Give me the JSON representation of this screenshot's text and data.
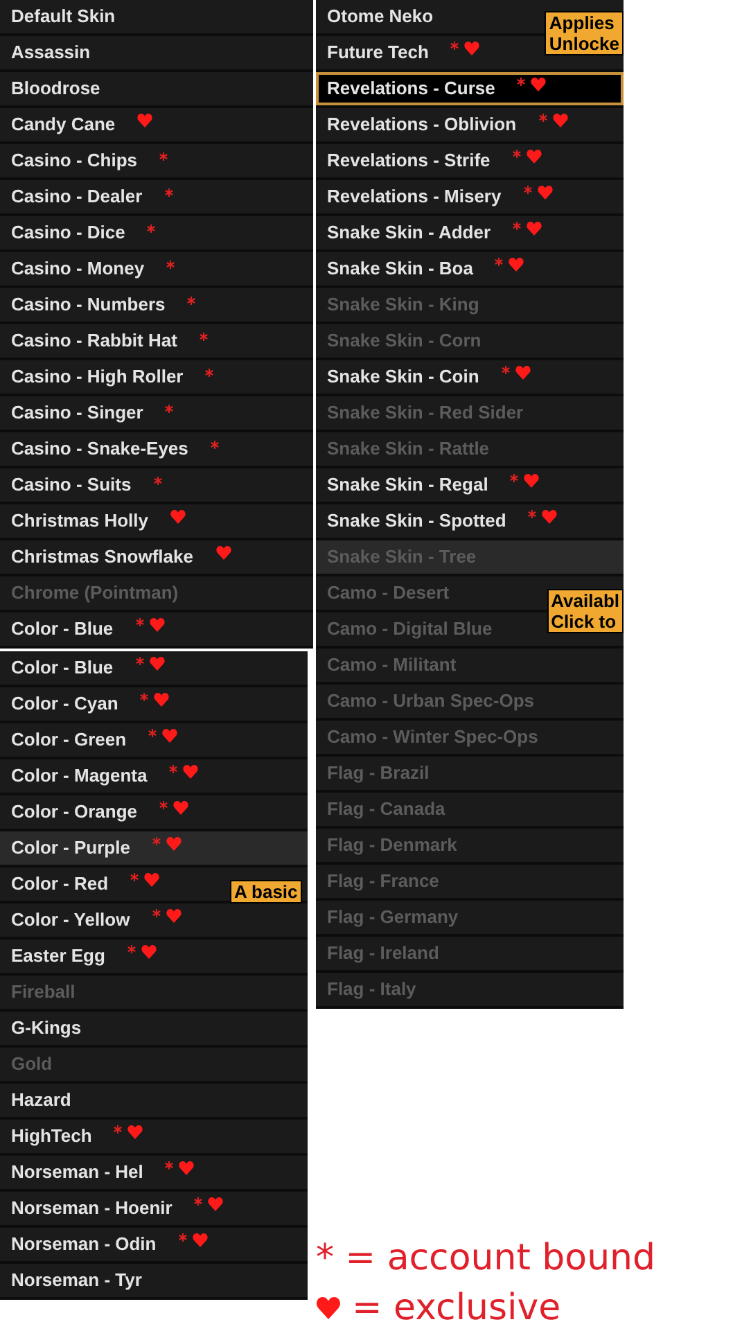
{
  "panels": [
    {
      "rows": [
        {
          "label": "Default Skin",
          "disabled": false,
          "account_bound": false,
          "exclusive": false,
          "selected": false,
          "highlighted": false
        },
        {
          "label": "Assassin",
          "disabled": false,
          "account_bound": false,
          "exclusive": false,
          "selected": false,
          "highlighted": false
        },
        {
          "label": "Bloodrose",
          "disabled": false,
          "account_bound": false,
          "exclusive": false,
          "selected": false,
          "highlighted": false
        },
        {
          "label": "Candy Cane",
          "disabled": false,
          "account_bound": false,
          "exclusive": true,
          "selected": false,
          "highlighted": false
        },
        {
          "label": "Casino - Chips",
          "disabled": false,
          "account_bound": true,
          "exclusive": false,
          "selected": false,
          "highlighted": false
        },
        {
          "label": "Casino - Dealer",
          "disabled": false,
          "account_bound": true,
          "exclusive": false,
          "selected": false,
          "highlighted": false
        },
        {
          "label": "Casino - Dice",
          "disabled": false,
          "account_bound": true,
          "exclusive": false,
          "selected": false,
          "highlighted": false
        },
        {
          "label": "Casino - Money",
          "disabled": false,
          "account_bound": true,
          "exclusive": false,
          "selected": false,
          "highlighted": false
        },
        {
          "label": "Casino - Numbers",
          "disabled": false,
          "account_bound": true,
          "exclusive": false,
          "selected": false,
          "highlighted": false
        },
        {
          "label": "Casino - Rabbit Hat",
          "disabled": false,
          "account_bound": true,
          "exclusive": false,
          "selected": false,
          "highlighted": false
        },
        {
          "label": "Casino - High Roller",
          "disabled": false,
          "account_bound": true,
          "exclusive": false,
          "selected": false,
          "highlighted": false
        },
        {
          "label": "Casino - Singer",
          "disabled": false,
          "account_bound": true,
          "exclusive": false,
          "selected": false,
          "highlighted": false
        },
        {
          "label": "Casino - Snake-Eyes",
          "disabled": false,
          "account_bound": true,
          "exclusive": false,
          "selected": false,
          "highlighted": false
        },
        {
          "label": "Casino - Suits",
          "disabled": false,
          "account_bound": true,
          "exclusive": false,
          "selected": false,
          "highlighted": false
        },
        {
          "label": "Christmas Holly",
          "disabled": false,
          "account_bound": false,
          "exclusive": true,
          "selected": false,
          "highlighted": false
        },
        {
          "label": "Christmas Snowflake",
          "disabled": false,
          "account_bound": false,
          "exclusive": true,
          "selected": false,
          "highlighted": false
        },
        {
          "label": "Chrome (Pointman)",
          "disabled": true,
          "account_bound": false,
          "exclusive": false,
          "selected": false,
          "highlighted": false
        },
        {
          "label": "Color - Blue",
          "disabled": false,
          "account_bound": true,
          "exclusive": true,
          "selected": false,
          "highlighted": false
        }
      ]
    },
    {
      "rows": [
        {
          "label": "Color - Blue",
          "disabled": false,
          "account_bound": true,
          "exclusive": true,
          "selected": false,
          "highlighted": false
        },
        {
          "label": "Color - Cyan",
          "disabled": false,
          "account_bound": true,
          "exclusive": true,
          "selected": false,
          "highlighted": false
        },
        {
          "label": "Color - Green",
          "disabled": false,
          "account_bound": true,
          "exclusive": true,
          "selected": false,
          "highlighted": false
        },
        {
          "label": "Color - Magenta",
          "disabled": false,
          "account_bound": true,
          "exclusive": true,
          "selected": false,
          "highlighted": false
        },
        {
          "label": "Color - Orange",
          "disabled": false,
          "account_bound": true,
          "exclusive": true,
          "selected": false,
          "highlighted": false
        },
        {
          "label": "Color - Purple",
          "disabled": false,
          "account_bound": true,
          "exclusive": true,
          "selected": false,
          "highlighted": true
        },
        {
          "label": "Color - Red",
          "disabled": false,
          "account_bound": true,
          "exclusive": true,
          "selected": false,
          "highlighted": false
        },
        {
          "label": "Color - Yellow",
          "disabled": false,
          "account_bound": true,
          "exclusive": true,
          "selected": false,
          "highlighted": false
        },
        {
          "label": "Easter Egg",
          "disabled": false,
          "account_bound": true,
          "exclusive": true,
          "selected": false,
          "highlighted": false
        },
        {
          "label": "Fireball",
          "disabled": true,
          "account_bound": false,
          "exclusive": false,
          "selected": false,
          "highlighted": false
        },
        {
          "label": "G-Kings",
          "disabled": false,
          "account_bound": false,
          "exclusive": false,
          "selected": false,
          "highlighted": false
        },
        {
          "label": "Gold",
          "disabled": true,
          "account_bound": false,
          "exclusive": false,
          "selected": false,
          "highlighted": false
        },
        {
          "label": "Hazard",
          "disabled": false,
          "account_bound": false,
          "exclusive": false,
          "selected": false,
          "highlighted": false
        },
        {
          "label": "HighTech",
          "disabled": false,
          "account_bound": true,
          "exclusive": true,
          "selected": false,
          "highlighted": false
        },
        {
          "label": "Norseman - Hel",
          "disabled": false,
          "account_bound": true,
          "exclusive": true,
          "selected": false,
          "highlighted": false
        },
        {
          "label": "Norseman - Hoenir",
          "disabled": false,
          "account_bound": true,
          "exclusive": true,
          "selected": false,
          "highlighted": false
        },
        {
          "label": "Norseman - Odin",
          "disabled": false,
          "account_bound": true,
          "exclusive": true,
          "selected": false,
          "highlighted": false
        },
        {
          "label": "Norseman - Tyr",
          "disabled": false,
          "account_bound": false,
          "exclusive": false,
          "selected": false,
          "highlighted": false
        }
      ],
      "tooltip": {
        "lines": [
          "A basic"
        ]
      }
    },
    {
      "rows": [
        {
          "label": "Otome Neko",
          "disabled": false,
          "account_bound": false,
          "exclusive": false,
          "selected": false,
          "highlighted": false
        },
        {
          "label": "Future Tech",
          "disabled": false,
          "account_bound": true,
          "exclusive": true,
          "selected": false,
          "highlighted": false
        },
        {
          "label": "Revelations - Curse",
          "disabled": false,
          "account_bound": true,
          "exclusive": true,
          "selected": true,
          "highlighted": false
        },
        {
          "label": "Revelations - Oblivion",
          "disabled": false,
          "account_bound": true,
          "exclusive": true,
          "selected": false,
          "highlighted": false
        },
        {
          "label": "Revelations - Strife",
          "disabled": false,
          "account_bound": true,
          "exclusive": true,
          "selected": false,
          "highlighted": false
        },
        {
          "label": "Revelations - Misery",
          "disabled": false,
          "account_bound": true,
          "exclusive": true,
          "selected": false,
          "highlighted": false
        },
        {
          "label": "Snake Skin - Adder",
          "disabled": false,
          "account_bound": true,
          "exclusive": true,
          "selected": false,
          "highlighted": false
        },
        {
          "label": "Snake Skin - Boa",
          "disabled": false,
          "account_bound": true,
          "exclusive": true,
          "selected": false,
          "highlighted": false
        },
        {
          "label": "Snake Skin - King",
          "disabled": true,
          "account_bound": false,
          "exclusive": false,
          "selected": false,
          "highlighted": false
        },
        {
          "label": "Snake Skin - Corn",
          "disabled": true,
          "account_bound": false,
          "exclusive": false,
          "selected": false,
          "highlighted": false
        }
      ],
      "tooltip": {
        "lines": [
          "Applies",
          "Unlocke"
        ]
      }
    },
    {
      "rows": [
        {
          "label": "Snake Skin - Coin",
          "disabled": false,
          "account_bound": true,
          "exclusive": true,
          "selected": false,
          "highlighted": false
        },
        {
          "label": "Snake Skin - Red Sider",
          "disabled": true,
          "account_bound": false,
          "exclusive": false,
          "selected": false,
          "highlighted": false
        },
        {
          "label": "Snake Skin - Rattle",
          "disabled": true,
          "account_bound": false,
          "exclusive": false,
          "selected": false,
          "highlighted": false
        },
        {
          "label": "Snake Skin - Regal",
          "disabled": false,
          "account_bound": true,
          "exclusive": true,
          "selected": false,
          "highlighted": false
        },
        {
          "label": "Snake Skin - Spotted",
          "disabled": false,
          "account_bound": true,
          "exclusive": true,
          "selected": false,
          "highlighted": false
        },
        {
          "label": "Snake Skin - Tree",
          "disabled": true,
          "account_bound": false,
          "exclusive": false,
          "selected": false,
          "highlighted": true
        },
        {
          "label": "Camo - Desert",
          "disabled": true,
          "account_bound": false,
          "exclusive": false,
          "selected": false,
          "highlighted": false
        },
        {
          "label": "Camo - Digital Blue",
          "disabled": true,
          "account_bound": false,
          "exclusive": false,
          "selected": false,
          "highlighted": false
        },
        {
          "label": "Camo - Militant",
          "disabled": true,
          "account_bound": false,
          "exclusive": false,
          "selected": false,
          "highlighted": false
        },
        {
          "label": "Camo - Urban Spec-Ops",
          "disabled": true,
          "account_bound": false,
          "exclusive": false,
          "selected": false,
          "highlighted": false
        },
        {
          "label": "Camo - Winter Spec-Ops",
          "disabled": true,
          "account_bound": false,
          "exclusive": false,
          "selected": false,
          "highlighted": false
        },
        {
          "label": "Flag - Brazil",
          "disabled": true,
          "account_bound": false,
          "exclusive": false,
          "selected": false,
          "highlighted": false
        },
        {
          "label": "Flag - Canada",
          "disabled": true,
          "account_bound": false,
          "exclusive": false,
          "selected": false,
          "highlighted": false
        },
        {
          "label": "Flag - Denmark",
          "disabled": true,
          "account_bound": false,
          "exclusive": false,
          "selected": false,
          "highlighted": false
        },
        {
          "label": "Flag - France",
          "disabled": true,
          "account_bound": false,
          "exclusive": false,
          "selected": false,
          "highlighted": false
        },
        {
          "label": "Flag - Germany",
          "disabled": true,
          "account_bound": false,
          "exclusive": false,
          "selected": false,
          "highlighted": false
        },
        {
          "label": "Flag - Ireland",
          "disabled": true,
          "account_bound": false,
          "exclusive": false,
          "selected": false,
          "highlighted": false
        },
        {
          "label": "Flag - Italy",
          "disabled": true,
          "account_bound": false,
          "exclusive": false,
          "selected": false,
          "highlighted": false
        }
      ],
      "tooltip": {
        "lines": [
          "Availabl",
          "Click to"
        ]
      }
    }
  ],
  "legend": {
    "account_bound": "* = account bound",
    "exclusive": "= exclusive"
  }
}
